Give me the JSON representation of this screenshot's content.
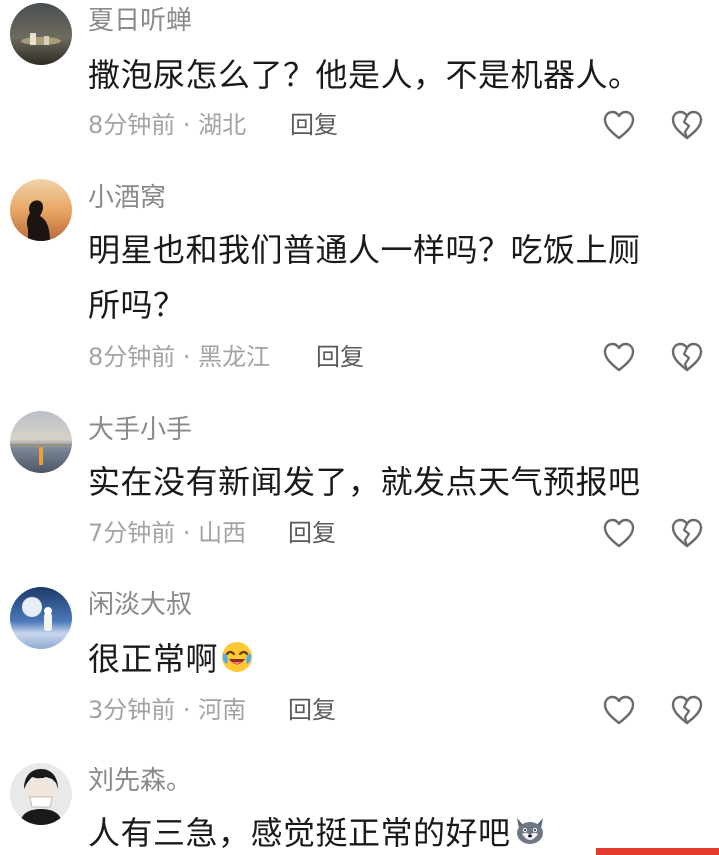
{
  "comments": [
    {
      "username": "夏日听蝉",
      "text": "撒泡尿怎么了？他是人，不是机器人。",
      "time": "8分钟前",
      "location": "湖北",
      "reply_label": "回复"
    },
    {
      "username": "小酒窝",
      "text_line1": "明星也和我们普通人一样吗？吃饭上厕",
      "text_line2": "所吗？",
      "time": "8分钟前",
      "location": "黑龙江",
      "reply_label": "回复"
    },
    {
      "username": "大手小手",
      "text": "实在没有新闻发了，就发点天气预报吧",
      "time": "7分钟前",
      "location": "山西",
      "reply_label": "回复"
    },
    {
      "username": "闲淡大叔",
      "text": "很正常啊",
      "emoji": "crying-laughing-emoji",
      "time": "3分钟前",
      "location": "河南",
      "reply_label": "回复"
    },
    {
      "username": "刘先森。",
      "text": "人有三急，感觉挺正常的好吧",
      "emoji": "husky-dog-emoji"
    }
  ],
  "meta_separator": " · ",
  "icons": {
    "like": "heart-outline-icon",
    "dislike": "broken-heart-icon"
  },
  "colors": {
    "username": "#8a8a8a",
    "text": "#1a1a1a",
    "meta": "#a3a3a3",
    "reply": "#5a5a5a",
    "icon": "#6b6b6b",
    "accent_red": "#e23b2e"
  }
}
